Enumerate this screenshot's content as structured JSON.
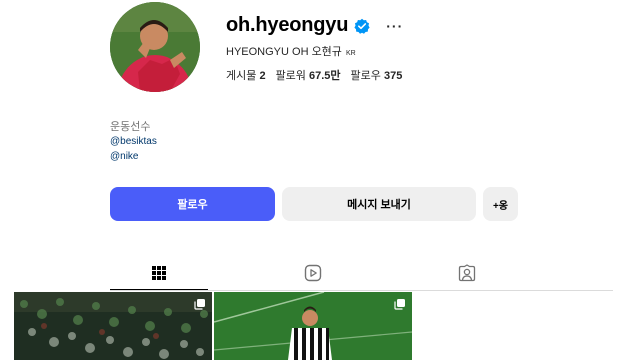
{
  "profile": {
    "username": "oh.hyeongyu",
    "full_name": "HYEONGYU OH 오현규",
    "country_badge": "KR",
    "category": "운동선수",
    "links": [
      "@besiktas",
      "@nike"
    ],
    "more_label": "···"
  },
  "stats": {
    "posts_label": "게시물",
    "posts_value": "2",
    "followers_label": "팔로워",
    "followers_value": "67.5만",
    "following_label": "팔로우",
    "following_value": "375"
  },
  "buttons": {
    "follow": "팔로우",
    "message": "메시지 보내기",
    "add_user": "+옹"
  },
  "tabs": [
    {
      "name": "posts",
      "icon": "grid-icon",
      "active": true
    },
    {
      "name": "reels",
      "icon": "reels-icon",
      "active": false
    },
    {
      "name": "tagged",
      "icon": "tagged-user-icon",
      "active": false
    }
  ],
  "colors": {
    "follow_button": "#4a5df9",
    "secondary_button": "#efefef",
    "verified_badge": "#0095f6",
    "link": "#00376b",
    "muted": "#737373"
  },
  "grid": [
    {
      "icon": "multiple-photos-icon"
    },
    {
      "icon": "multiple-photos-icon"
    }
  ]
}
